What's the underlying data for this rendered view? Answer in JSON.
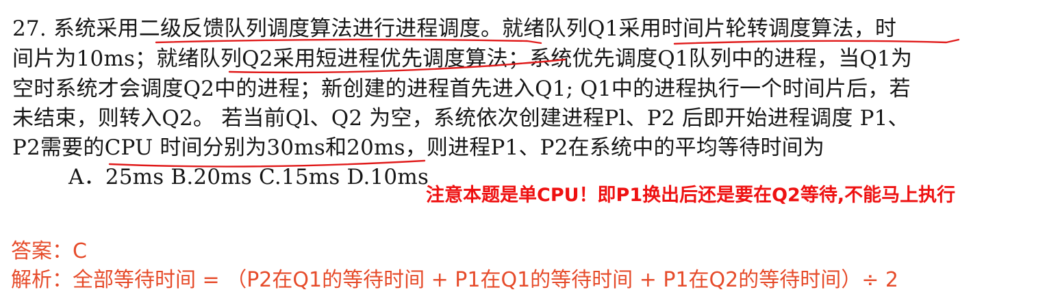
{
  "question": {
    "line1": "27. 系统采用二级反馈队列调度算法进行进程调度。就绪队列Q1采用时间片轮转调度算法，时",
    "line2": "间片为10ms；就绪队列Q2采用短进程优先调度算法；系统优先调度Q1队列中的进程，当Q1为",
    "line3": "空时系统才会调度Q2中的进程；新创建的进程首先进入Q1; Q1中的进程执行一个时间片后，若",
    "line4": "未结束，则转入Q2。 若当前Ql、Q2 为空，系统依次创建进程Pl、P2 后即开始进程调度 P1、",
    "line5": "P2需要的CPU 时间分别为30ms和20ms，则进程P1、P2在系统中的平均等待时间为",
    "options": "A．25ms B.20ms C.15ms D.10ms"
  },
  "note": "注意本题是单CPU！即P1换出后还是要在Q2等待,不能马上执行",
  "answer": {
    "line": "答案：C",
    "explanation": "解析：全部等待时间 = （P2在Q1的等待时间 + P1在Q1的等待时间 + P1在Q2的等待时间）÷ 2"
  },
  "colors": {
    "text": "#161616",
    "note": "#ee1111",
    "answer": "#e64b2a",
    "underline": "#e01a1a"
  }
}
